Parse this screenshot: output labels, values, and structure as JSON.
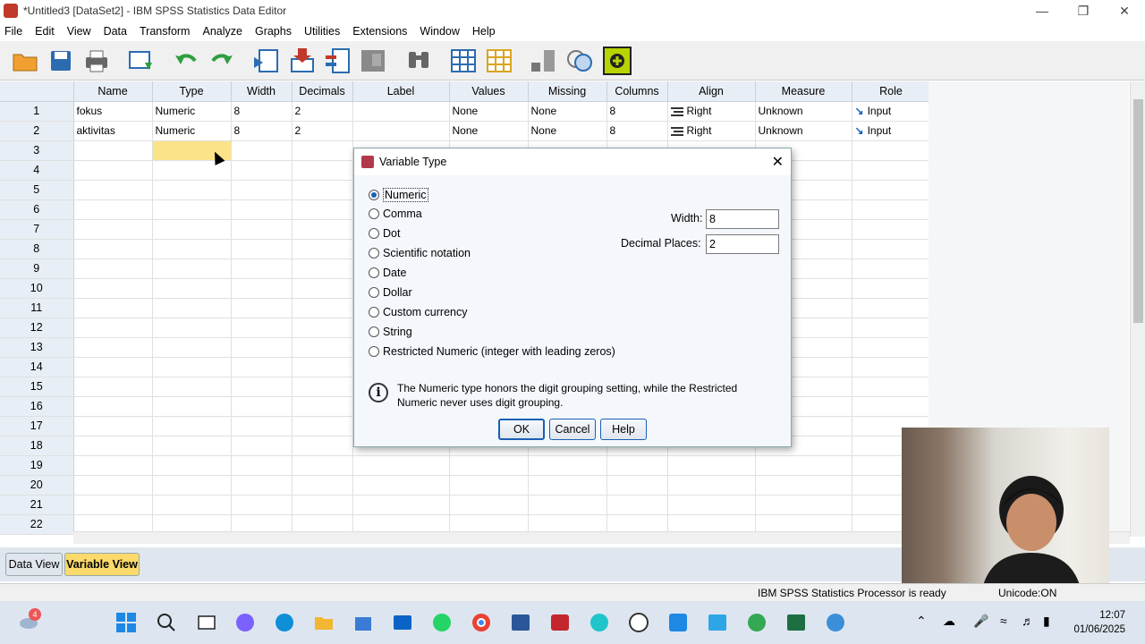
{
  "window": {
    "title": "*Untitled3 [DataSet2] - IBM SPSS Statistics Data Editor"
  },
  "menu": [
    "File",
    "Edit",
    "View",
    "Data",
    "Transform",
    "Analyze",
    "Graphs",
    "Utilities",
    "Extensions",
    "Window",
    "Help"
  ],
  "grid": {
    "columns": [
      "Name",
      "Type",
      "Width",
      "Decimals",
      "Label",
      "Values",
      "Missing",
      "Columns",
      "Align",
      "Measure",
      "Role"
    ],
    "rows": [
      {
        "num": "1",
        "name": "fokus",
        "type": "Numeric",
        "width": "8",
        "decimals": "2",
        "label": "",
        "values": "None",
        "missing": "None",
        "columns": "8",
        "align": "Right",
        "measure": "Unknown",
        "role": "Input"
      },
      {
        "num": "2",
        "name": "aktivitas",
        "type": "Numeric",
        "width": "8",
        "decimals": "2",
        "label": "",
        "values": "None",
        "missing": "None",
        "columns": "8",
        "align": "Right",
        "measure": "Unknown",
        "role": "Input"
      }
    ],
    "empty_row_numbers": [
      "3",
      "4",
      "5",
      "6",
      "7",
      "8",
      "9",
      "10",
      "11",
      "12",
      "13",
      "14",
      "15",
      "16",
      "17",
      "18",
      "19",
      "20",
      "21",
      "22"
    ]
  },
  "tabs": {
    "data_view": "Data View",
    "variable_view": "Variable View"
  },
  "status": {
    "processor": "IBM SPSS Statistics Processor is ready",
    "unicode": "Unicode:ON"
  },
  "taskbar": {
    "time": "12:07",
    "date": "01/06/2025",
    "weather_badge": "4"
  },
  "dialog": {
    "title": "Variable Type",
    "options": [
      "Numeric",
      "Comma",
      "Dot",
      "Scientific notation",
      "Date",
      "Dollar",
      "Custom currency",
      "String",
      "Restricted Numeric (integer with leading zeros)"
    ],
    "selected": "Numeric",
    "width_label": "Width:",
    "width_value": "8",
    "decimals_label": "Decimal Places:",
    "decimals_value": "2",
    "info": "The Numeric type honors the digit grouping setting, while the Restricted Numeric never uses digit grouping.",
    "ok": "OK",
    "cancel": "Cancel",
    "help": "Help"
  }
}
